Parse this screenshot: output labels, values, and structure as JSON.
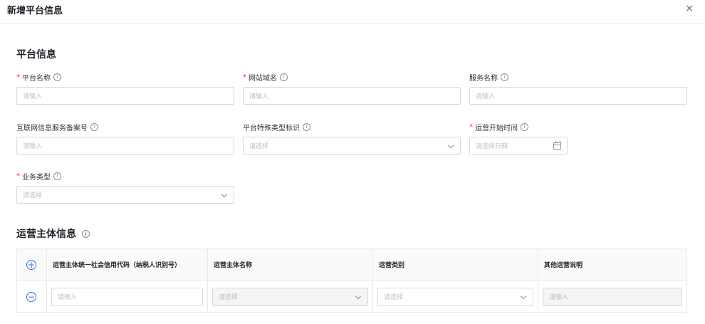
{
  "dialog": {
    "title": "新增平台信息",
    "close_label": "×"
  },
  "sections": {
    "platform": "平台信息",
    "operator": "运营主体信息"
  },
  "fields": {
    "platform_name": {
      "label": "平台名称",
      "required": "*",
      "placeholder": "请输入"
    },
    "domain": {
      "label": "网站域名",
      "required": "*",
      "placeholder": "请输入"
    },
    "service_name": {
      "label": "服务名称",
      "placeholder": "请输入"
    },
    "icp": {
      "label": "互联网信息服务备案号",
      "placeholder": "请输入"
    },
    "special_type": {
      "label": "平台特殊类型标识",
      "placeholder": "请选择"
    },
    "start_time": {
      "label": "运营开始时间",
      "required": "*",
      "placeholder": "请选择日期"
    },
    "business_type": {
      "label": "业务类型",
      "required": "*",
      "placeholder": "请选择"
    }
  },
  "info_glyph": "i",
  "table": {
    "add_glyph": "+",
    "remove_glyph": "−",
    "headers": [
      "运营主体统一社会信用代码（纳税人识别号）",
      "运营主体名称",
      "运营类别",
      "其他运营说明"
    ],
    "row": {
      "credit_code_placeholder": "请输入",
      "name_placeholder": "请选择",
      "category_placeholder": "请选择",
      "other_placeholder": "请输入"
    }
  }
}
